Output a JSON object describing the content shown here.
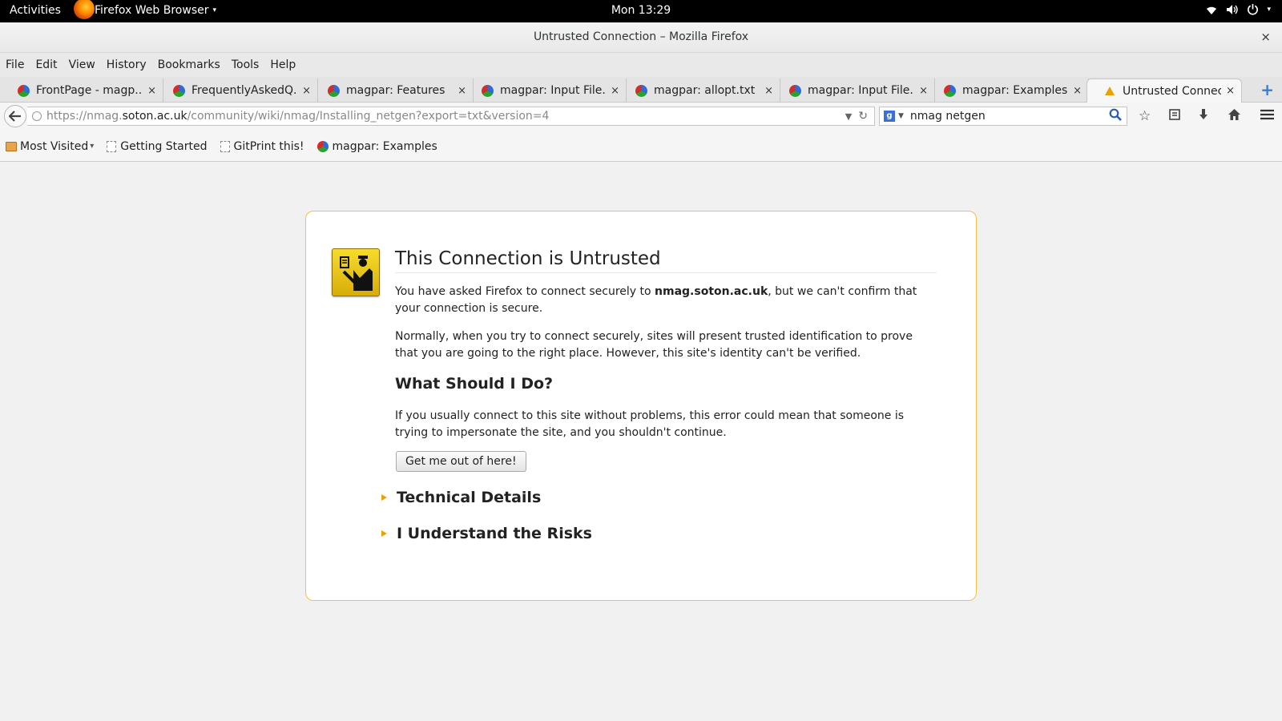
{
  "topbar": {
    "activities": "Activities",
    "app_name": "Firefox Web Browser",
    "app_caret": "▾",
    "clock": "Mon 13:29"
  },
  "window": {
    "title": "Untrusted Connection – Mozilla Firefox",
    "close": "×"
  },
  "menubar": {
    "items": [
      "File",
      "Edit",
      "View",
      "History",
      "Bookmarks",
      "Tools",
      "Help"
    ]
  },
  "tabs": [
    {
      "label": "FrontPage - magp...",
      "icon": "magpar-favicon"
    },
    {
      "label": "FrequentlyAskedQ...",
      "icon": "magpar-favicon"
    },
    {
      "label": "magpar: Features",
      "icon": "magpar-favicon"
    },
    {
      "label": "magpar: Input File...",
      "icon": "magpar-favicon"
    },
    {
      "label": "magpar: allopt.txt",
      "icon": "magpar-favicon"
    },
    {
      "label": "magpar: Input File...",
      "icon": "magpar-favicon"
    },
    {
      "label": "magpar: Examples",
      "icon": "magpar-favicon"
    },
    {
      "label": "Untrusted Connec...",
      "icon": "warning-icon",
      "active": true
    }
  ],
  "tab_close": "×",
  "newtab": "+",
  "navbar": {
    "url_prefix": "https://nmag.",
    "url_host": "soton.ac.uk",
    "url_path": "/community/wiki/nmag/Installing_netgen?export=txt&version=4",
    "search_engine": "g",
    "search_value": "nmag netgen"
  },
  "bookmarks": {
    "items": [
      {
        "label": "Most Visited",
        "icon": "folder-icon"
      },
      {
        "label": "Getting Started",
        "icon": "page-icon"
      },
      {
        "label": "GitPrint this!",
        "icon": "page-icon"
      },
      {
        "label": "magpar: Examples",
        "icon": "magpar-favicon"
      }
    ]
  },
  "error_page": {
    "title": "This Connection is Untrusted",
    "para1_pre": "You have asked Firefox to connect securely to ",
    "para1_host": "nmag.soton.ac.uk",
    "para1_post": ", but we can't confirm that your connection is secure.",
    "para2": "Normally, when you try to connect securely, sites will present trusted identification to prove that you are going to the right place. However, this site's identity can't be verified.",
    "what_heading": "What Should I Do?",
    "para3": "If you usually connect to this site without problems, this error could mean that someone is trying to impersonate the site, and you shouldn't continue.",
    "getout_button": "Get me out of here!",
    "technical_details": "Technical Details",
    "understand_risks": "I Understand the Risks",
    "colors": {
      "border": "#f0c24a",
      "icon_yellow": "#f0cc1c",
      "expander": "#e8a300"
    }
  }
}
